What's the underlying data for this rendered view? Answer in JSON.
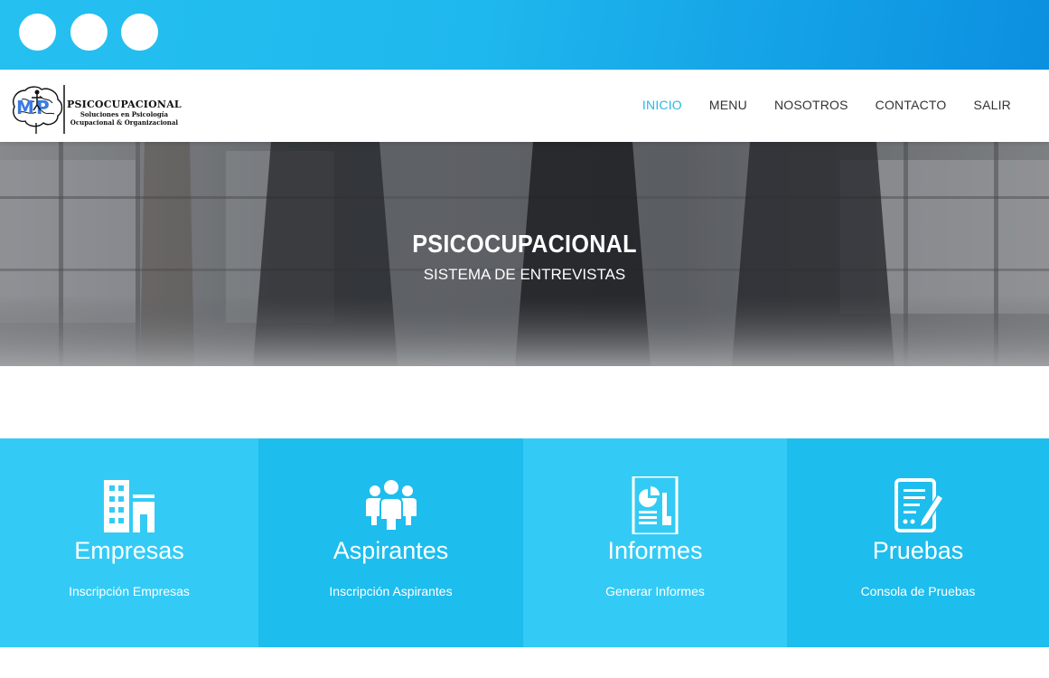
{
  "colors": {
    "top_bar": "#1fb8ee",
    "accent": "#29b6e8",
    "tile_light": "#33cbf6",
    "tile_dark": "#1dbdee"
  },
  "social": [
    {
      "icon": "social-circle-icon"
    },
    {
      "icon": "social-circle-icon"
    },
    {
      "icon": "social-circle-icon"
    }
  ],
  "logo": {
    "title": "PSICOCUPACIONAL",
    "subtitle_line1": "Soluciones en Psicología",
    "subtitle_line2": "Ocupacional & Organizacional"
  },
  "nav": {
    "items": [
      {
        "label": "INICIO",
        "active": true
      },
      {
        "label": "MENU",
        "active": false
      },
      {
        "label": "NOSOTROS",
        "active": false
      },
      {
        "label": "CONTACTO",
        "active": false
      },
      {
        "label": "SALIR",
        "active": false
      }
    ]
  },
  "hero": {
    "title": "PSICOCUPACIONAL",
    "subtitle": "SISTEMA DE ENTREVISTAS"
  },
  "tiles": [
    {
      "icon": "building-icon",
      "title": "Empresas",
      "link": "Inscripción Empresas"
    },
    {
      "icon": "people-group-icon",
      "title": "Aspirantes",
      "link": "Inscripción Aspirantes"
    },
    {
      "icon": "report-chart-icon",
      "title": "Informes",
      "link": "Generar Informes"
    },
    {
      "icon": "test-document-icon",
      "title": "Pruebas",
      "link": "Consola de Pruebas"
    }
  ]
}
